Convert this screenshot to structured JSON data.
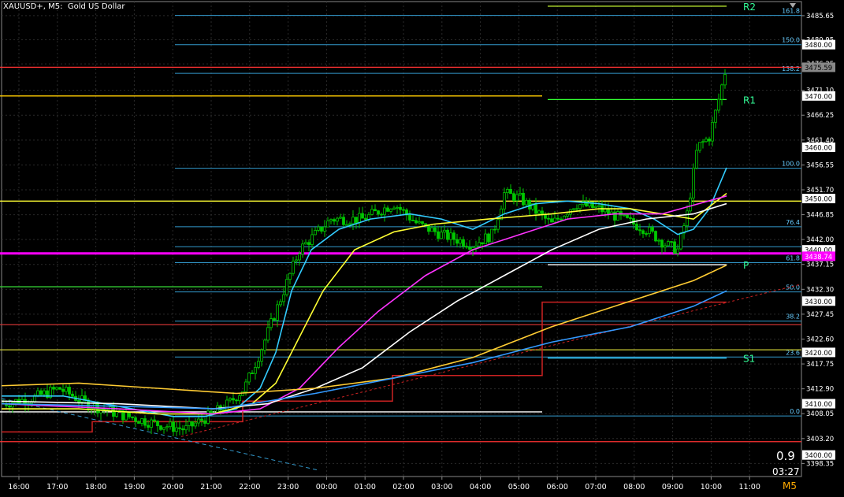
{
  "header": {
    "symbol": "XAUUSD+",
    "timeframe": "M5",
    "title": "Gold US Dollar"
  },
  "info": {
    "spread": "0.9",
    "timer": "03:27",
    "timeframe_label": "M5"
  },
  "colors": {
    "background": "#000000",
    "grid": "#2a2a2a",
    "candle": "#00c800",
    "ma_cyan": "#33ccff",
    "ma_yellow": "#ffff33",
    "ma_magenta": "#ff33ff",
    "ma_white": "#ffffff",
    "ma_gold": "#ffcc33",
    "ma_blue": "#3399ff",
    "fib": "#3399cc",
    "pivot_line": "#cccc33"
  },
  "chart_data": {
    "type": "candlestick",
    "y_range": [
      3395.8,
      3488.4
    ],
    "price_ticks": [
      "3485.65",
      "3480.95",
      "3476.25",
      "3471.10",
      "3466.25",
      "3461.40",
      "3456.55",
      "3451.70",
      "3446.85",
      "3442.00",
      "3437.15",
      "3432.30",
      "3427.45",
      "3422.60",
      "3417.75",
      "3412.90",
      "3408.05",
      "3403.20",
      "3398.35"
    ],
    "price_boxes": [
      {
        "label": "3480.00",
        "price": 3480.0
      },
      {
        "label": "3475.59",
        "price": 3475.59,
        "bid": true
      },
      {
        "label": "3470.00",
        "price": 3470.0
      },
      {
        "label": "3460.00",
        "price": 3460.0
      },
      {
        "label": "3450.00",
        "price": 3450.0
      },
      {
        "label": "3440.00",
        "price": 3440.0
      },
      {
        "label": "3438.74",
        "price": 3438.74,
        "magenta": true
      },
      {
        "label": "3430.00",
        "price": 3430.0
      },
      {
        "label": "3420.00",
        "price": 3420.0
      },
      {
        "label": "3410.00",
        "price": 3410.0
      },
      {
        "label": "3400.00",
        "price": 3400.0
      }
    ],
    "time_ticks": [
      "16:00",
      "17:00",
      "18:00",
      "19:00",
      "20:00",
      "21:00",
      "22:00",
      "23:00",
      "00:00",
      "01:00",
      "02:00",
      "03:00",
      "04:00",
      "05:00",
      "06:00",
      "07:00",
      "08:00",
      "09:00",
      "10:00",
      "11:00"
    ],
    "fib_levels": [
      {
        "label": "161.8",
        "price": 3485.7
      },
      {
        "label": "150.0",
        "price": 3480.0
      },
      {
        "label": "138.2",
        "price": 3474.4
      },
      {
        "label": "100.0",
        "price": 3455.9
      },
      {
        "label": "76.4",
        "price": 3444.5
      },
      {
        "label": "",
        "price": 3440.6
      },
      {
        "label": "61.8",
        "price": 3437.5
      },
      {
        "label": "50.0",
        "price": 3431.8
      },
      {
        "label": "38.2",
        "price": 3426.1
      },
      {
        "label": "23.6",
        "price": 3419.1
      },
      {
        "label": "0.0",
        "price": 3407.6
      }
    ],
    "pivot_labels": [
      {
        "label": "R2",
        "price": 3487.5
      },
      {
        "label": "R1",
        "price": 3469.3
      },
      {
        "label": "P",
        "price": 3437.1
      },
      {
        "label": "S1",
        "price": 3418.9
      }
    ],
    "horizontal_lines": [
      {
        "price": 3475.6,
        "color": "#ff3333",
        "from": 0,
        "to": 1017
      },
      {
        "price": 3470.0,
        "color": "#ffcc00",
        "from": 0,
        "to": 688
      },
      {
        "price": 3449.5,
        "color": "#ffff33",
        "from": 0,
        "to": 1017
      },
      {
        "price": 3439.3,
        "color": "#ff00ff",
        "from": 0,
        "to": 1017,
        "width": 3
      },
      {
        "price": 3432.8,
        "color": "#33cc33",
        "from": 0,
        "to": 688
      },
      {
        "price": 3425.4,
        "color": "#cc3333",
        "from": 0,
        "to": 1017
      },
      {
        "price": 3420.5,
        "color": "#cccc33",
        "from": 0,
        "to": 1017
      },
      {
        "price": 3408.4,
        "color": "#ffffff",
        "from": 0,
        "to": 688
      },
      {
        "price": 3402.6,
        "color": "#ff3333",
        "from": 0,
        "to": 1017
      },
      {
        "price": 3487.5,
        "color": "#ccff33",
        "from": 695,
        "to": 922
      },
      {
        "price": 3469.3,
        "color": "#33ff33",
        "from": 695,
        "to": 922
      },
      {
        "price": 3437.1,
        "color": "#ffffff",
        "from": 695,
        "to": 922
      },
      {
        "price": 3418.9,
        "color": "#33ccff",
        "from": 695,
        "to": 922
      }
    ]
  }
}
